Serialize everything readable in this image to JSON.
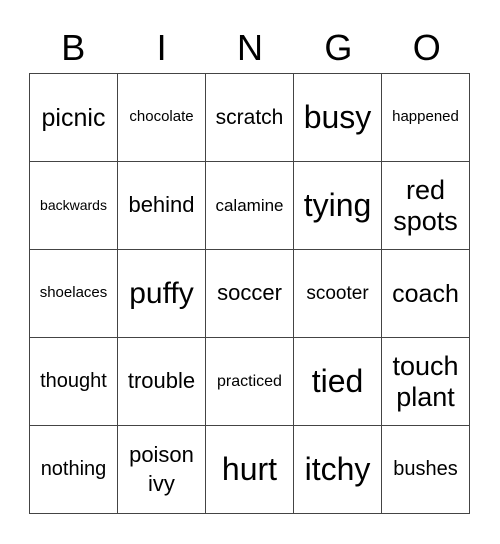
{
  "header": {
    "letters": [
      "B",
      "I",
      "N",
      "G",
      "O"
    ]
  },
  "board": {
    "rows": [
      [
        "picnic",
        "chocolate",
        "scratch",
        "busy",
        "happened"
      ],
      [
        "backwards",
        "behind",
        "calamine",
        "tying",
        "red spots"
      ],
      [
        "shoelaces",
        "puffy",
        "soccer",
        "scooter",
        "coach"
      ],
      [
        "thought",
        "trouble",
        "practiced",
        "tied",
        "touch plant"
      ],
      [
        "nothing",
        "poison ivy",
        "hurt",
        "itchy",
        "bushes"
      ]
    ]
  }
}
